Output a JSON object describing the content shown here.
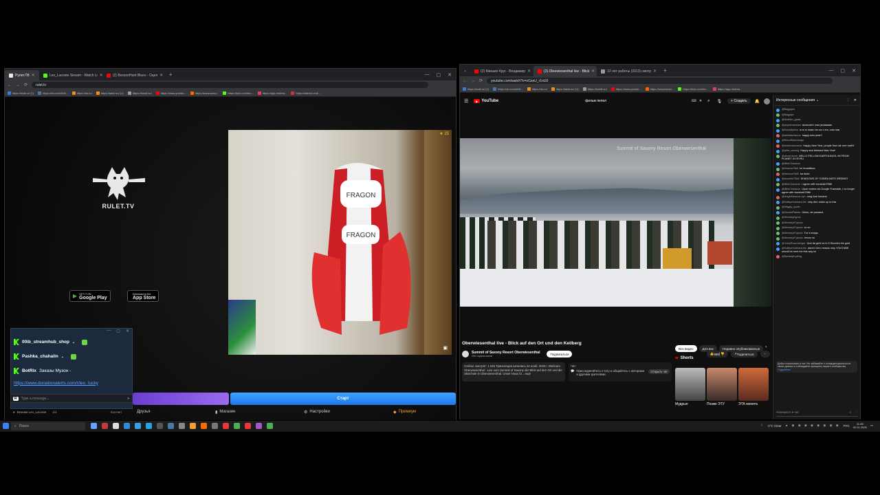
{
  "left_browser": {
    "tabs": [
      {
        "title": "Рулет.ТВ",
        "active": true,
        "color": "#e8eaed"
      },
      {
        "title": "Leo_Lacoste Stream - Watch Li",
        "active": false,
        "color": "#53fc18"
      },
      {
        "title": "(2) BoxsonHunt Blues - Оцел",
        "active": false,
        "color": "#ff0000"
      }
    ],
    "url": "rulet.tv",
    "bookmarks": [
      {
        "label": "https://mali.ru/ (1)",
        "color": "#3a7bd5"
      },
      {
        "label": "https://vk.com/id18...",
        "color": "#4a76a8"
      },
      {
        "label": "https://ok.ru/",
        "color": "#f28a1c"
      },
      {
        "label": "https://tanki.su/ (1)",
        "color": "#f28a1c"
      },
      {
        "label": "https://kordil.su/",
        "color": "#999999"
      },
      {
        "label": "https://www.youtub...",
        "color": "#ff0000"
      },
      {
        "label": "https://www.tansu...",
        "color": "#ff6600"
      },
      {
        "label": "https://kick.com/leo...",
        "color": "#53fc18"
      },
      {
        "label": "https://app.restrea...",
        "color": "#e63d5f"
      },
      {
        "label": "https://distrtco.md/...",
        "color": "#cc3333"
      }
    ],
    "logo_text": "RULET.TV",
    "google_play": {
      "small": "GET IT ON",
      "big": "Google Play"
    },
    "app_store": {
      "small": "Download on the",
      "big": "App Store"
    },
    "video_badge": "25",
    "chat": {
      "users": [
        {
          "name": "00ib_streamhub_shop"
        },
        {
          "name": "Pashka_chahalin"
        },
        {
          "name": "BotRix",
          "message": "Заказы Музон -"
        }
      ],
      "link": "https://www.donationalerts.com/r/leo_lucky",
      "input_placeholder": "Type a message...",
      "input_prefix": "R"
    },
    "next_button": "Старт",
    "nav": {
      "user": "Везним Leo_Lacoste",
      "user_stats": "1/1",
      "user_tail": "Контакт",
      "friends": "Друзья",
      "shop": "Магазин",
      "settings": "Настройки",
      "premium": "Премиум"
    }
  },
  "right_browser": {
    "tabs": [
      {
        "title": "(2) Михаил Круг - Владимир",
        "active": false,
        "color": "#ff0000"
      },
      {
        "title": "(2) Oberwiesenthal live - Blick",
        "active": true,
        "color": "#ff0000"
      },
      {
        "title": "12 лет работы (2013) смотр",
        "active": false,
        "color": "#999999"
      }
    ],
    "url": "youtube.com/watch?v=oGzeU_r1nU0",
    "bookmarks": [
      {
        "label": "https://mali.ru/ (1)",
        "color": "#3a7bd5"
      },
      {
        "label": "https://vk.com/id18...",
        "color": "#4a76a8"
      },
      {
        "label": "https://ok.ru/",
        "color": "#f28a1c"
      },
      {
        "label": "https://tanki.su/ (1)",
        "color": "#f28a1c"
      },
      {
        "label": "https://kordil.su/",
        "color": "#999999"
      },
      {
        "label": "https://www.youtub...",
        "color": "#ff0000"
      },
      {
        "label": "https://www.tansu...",
        "color": "#ff6600"
      },
      {
        "label": "https://kick.com/leo...",
        "color": "#53fc18"
      },
      {
        "label": "https://app.restrea...",
        "color": "#e63d5f"
      }
    ],
    "youtube": {
      "logo": "YouTube",
      "search_value": "фильм пепел",
      "create": "Создать",
      "video_caption": "Summit of Saxony Resort Oberwiesenthal",
      "title": "Oberwiesenthal live - Blick auf den Ort und den Keilberg",
      "channel": "Summit of Saxony Resort Oberwiesenthal",
      "subscribers": "25К подписчиков",
      "subscribe": "Подписаться",
      "likes": "888",
      "share": "Поделиться",
      "description": "Сейчас смотрят: 1 046 Трансляция началась 24 нояб. 2023 г. Webcam Oberwiesenthal - Live vom Summit of Saxony der Blick auf den Ort und die Skischule in Oberwiesenthal. Unser Haus fü ...ещё",
      "chat_card_label": "Чат",
      "chat_card_text": "Присоединяйтесь к чату и общайтесь с авторами и другими зрителями.",
      "chat_card_button": "Открыть чат",
      "chips": [
        "Все видео",
        "Для вас",
        "Недавно опубликованные"
      ],
      "shorts_title": "Shorts",
      "shorts": [
        {
          "label": "Мудрые",
          "color": "#6a6a6a"
        },
        {
          "label": "Позже ЭТУ",
          "color": "#b05a3a"
        },
        {
          "label": "ЭТА монета",
          "color": "#c05040"
        }
      ]
    },
    "live_chat": {
      "header": "Интересные сообщения",
      "messages": [
        {
          "name": "@Bagpiper",
          "text": "",
          "color": "#3ea6ff"
        },
        {
          "name": "@Bagpipe",
          "text": "",
          "color": "#6fbf73"
        },
        {
          "name": "@Ibrahim_gaatc",
          "text": "",
          "color": "#3ea6ff"
        },
        {
          "name": "@yeyekmandavi",
          "text": "включите глаз уеззываю",
          "color": "#6fbf73"
        },
        {
          "name": "@Karkakpiroo",
          "text": "ю ю ю знаю что за з это, ком нож",
          "color": "#3ea6ff"
        },
        {
          "name": "@amitdamianun",
          "text": "happy new year!!",
          "color": "#e06666"
        },
        {
          "name": "@BarvaMoscowgo",
          "text": "",
          "color": "#3ea6ff"
        },
        {
          "name": "@mobiussonacia",
          "text": "Happy New Year, people from all over earth!",
          "color": "#e06666"
        },
        {
          "name": "@pets_cunxeg",
          "text": "Happy and blessed New Year!",
          "color": "#3ea6ff"
        },
        {
          "name": "@peoerrisme",
          "text": "HELLO FELLOW EARTHLINGS, IM FROM PLANET X3 RYRU",
          "color": "#6fbf73"
        },
        {
          "name": "@iBimChisazon",
          "text": "",
          "color": "#3ea6ff"
        },
        {
          "name": "@irinavia7566",
          "text": "ini breadbkov",
          "color": "#6fbf73"
        },
        {
          "name": "@irenova7566",
          "text": "ba dodo",
          "color": "#e06666"
        },
        {
          "name": "@murshki7566",
          "text": "SHADOWS OF COBRA NATO BRDBKO",
          "color": "#3ea6ff"
        },
        {
          "name": "@iBimChisazon",
          "text": "I agree with trundukb7566",
          "color": "#6fbf73"
        },
        {
          "name": "@iBimChisazon",
          "text": "Upon review via Google Translate, I no longer agree with trundukb7566",
          "color": "#3ea6ff"
        },
        {
          "name": "@AngleMoscow-xyh",
          "text": "omg look bavaria",
          "color": "#e06666"
        },
        {
          "name": "@KatilynHubbard-hfc",
          "text": "why did i wake up to this",
          "color": "#3ea6ff"
        },
        {
          "name": "@Wiggly_youth",
          "text": "",
          "color": "#6fbf73"
        },
        {
          "name": "@ZundelPaketo",
          "text": "Gelox, de panamá",
          "color": "#3ea6ff"
        },
        {
          "name": "@Alexseyrtypos",
          "text": "",
          "color": "#6fbf73"
        },
        {
          "name": "@AlexseyrFypcos",
          "text": "",
          "color": "#6fbf73"
        },
        {
          "name": "@AlexseyrFypcos",
          "text": "хо хо",
          "color": "#6fbf73"
        },
        {
          "name": "@AlexseyrFypcos",
          "text": "Тот в кладь",
          "color": "#6fbf73"
        },
        {
          "name": "@AlexseyrFypcos",
          "text": "тепло хо",
          "color": "#6fbf73"
        },
        {
          "name": "@JoelyRosenberger",
          "text": "Und da geht es in 5 Stunden hin gold",
          "color": "#3ea6ff"
        },
        {
          "name": "@KatilynHubbard-hfc",
          "text": "damn! Zero reason why YOUTUBE should've sent me this way lol",
          "color": "#3ea6ff"
        },
        {
          "name": "@Bardolph-pfmg",
          "text": "",
          "color": "#e06666"
        }
      ],
      "notice": "Добро пожаловать в чат! Не забывайте о конфиденциальности своих данных и соблюдайте принципы нашего сообщества.",
      "notice_link": "Подробнее",
      "input_placeholder": "Напишите в чат"
    }
  },
  "taskbar": {
    "search_placeholder": "Поиск",
    "weather": "-2°C Clear",
    "language": "РУС",
    "time": "11:48",
    "date": "02.01.2025"
  }
}
